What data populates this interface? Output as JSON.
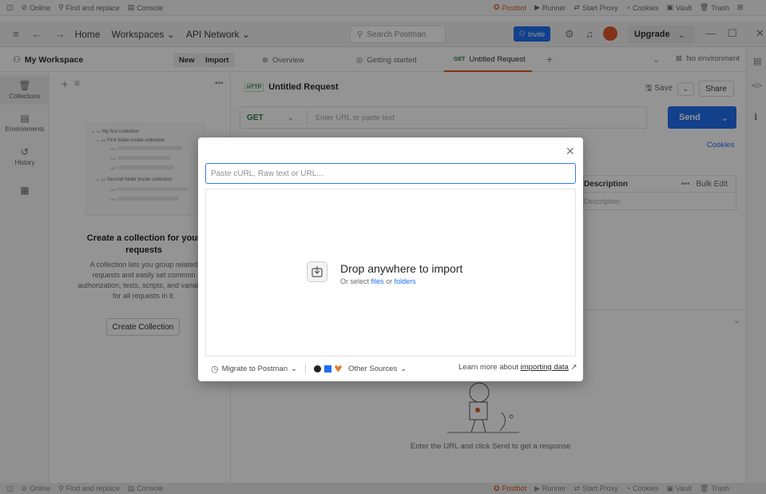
{
  "statusbar": {
    "online": "Online",
    "find_replace": "Find and replace",
    "console": "Console",
    "postbot": "Postbot",
    "runner": "Runner",
    "start_proxy": "Start Proxy",
    "cookies": "Cookies",
    "vault": "Vault",
    "trash": "Trash"
  },
  "header": {
    "home": "Home",
    "workspaces": "Workspaces",
    "api_network": "API Network",
    "search_placeholder": "Search Postman",
    "invite": "Invite",
    "upgrade": "Upgrade"
  },
  "workspace": {
    "name": "My Workspace",
    "new_label": "New",
    "import_label": "Import"
  },
  "tabs": [
    {
      "label": "Overview"
    },
    {
      "label": "Getting started"
    },
    {
      "method": "GET",
      "label": "Untitled Request"
    }
  ],
  "environment": "No environment",
  "rail": {
    "items": [
      {
        "label": "Collections",
        "icon": "collections-icon"
      },
      {
        "label": "Environments",
        "icon": "environments-icon"
      },
      {
        "label": "History",
        "icon": "history-icon"
      },
      {
        "label": "",
        "icon": "apps-grid-icon"
      }
    ]
  },
  "collections_pane": {
    "illustration": {
      "collection_name": "My first collection",
      "folder_1": "First folder inside collection",
      "folder_2": "Second folder inside collection",
      "methods": [
        "GET",
        "PUT",
        "GET",
        "GET",
        "GET"
      ]
    },
    "title": "Create a collection for your requests",
    "description": "A collection lets you group related requests and easily set common authorization, tests, scripts, and variables for all requests in it.",
    "create_button": "Create Collection"
  },
  "request": {
    "title": "Untitled Request",
    "save": "Save",
    "share": "Share",
    "method": "GET",
    "url_placeholder": "Enter URL or paste text",
    "send": "Send",
    "cookies": "Cookies",
    "params_header": "Description",
    "bulk_edit": "Bulk Edit",
    "params_placeholder": "Description",
    "response_hint": "Enter the URL and click Send to get a response"
  },
  "import_dialog": {
    "input_placeholder": "Paste cURL, Raw text or URL...",
    "drop_title": "Drop anywhere to import",
    "drop_sub_prefix": "Or select",
    "drop_files": "files",
    "drop_or": "or",
    "drop_folders": "folders",
    "migrate": "Migrate to Postman",
    "other_sources": "Other Sources",
    "learn_prefix": "Learn more about",
    "learn_link": "importing data"
  },
  "colors": {
    "accent_orange": "#e0572a",
    "primary_blue": "#1f6ff0",
    "get_green": "#217f3c"
  }
}
